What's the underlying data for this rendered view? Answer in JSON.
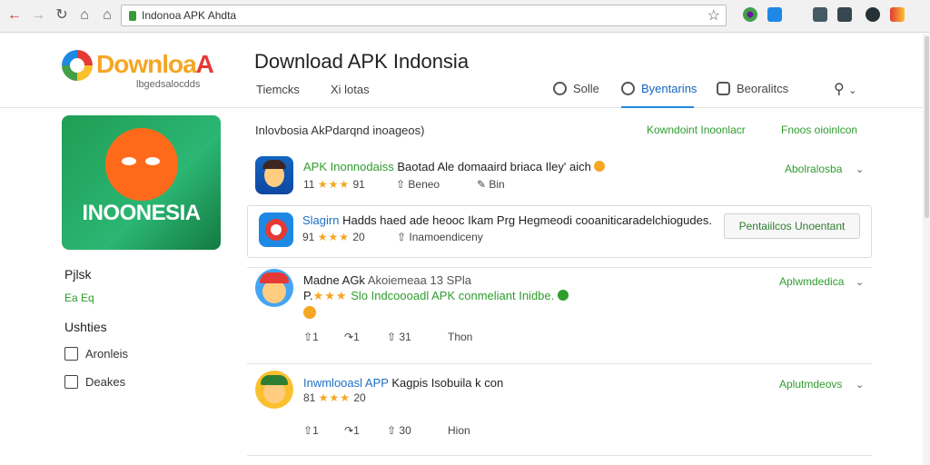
{
  "browser": {
    "url": "Indonoa APK Ahdta",
    "back_icon": "arrow-left-icon",
    "forward_icon": "arrow-right-icon",
    "reload_icon": "reload-icon",
    "home_icon": "home-icon",
    "bookmark_icon": "star-icon"
  },
  "header": {
    "logo_main": "Downloa",
    "logo_accent": "A",
    "logo_sub": "lbgedsalocdds",
    "title": "Download APK Indonsia",
    "subnav": [
      "Tiemcks",
      "Xi lotas"
    ],
    "tabs": [
      {
        "label": "Solle",
        "active": false
      },
      {
        "label": "Byentarins",
        "active": true
      },
      {
        "label": "Beoralitcs",
        "active": false
      }
    ]
  },
  "sidebar": {
    "hero_text": "INOONESIA",
    "section1_title": "Pjlsk",
    "section1_sub": "Ea Eq",
    "section2_title": "Ushties",
    "links": [
      "Aronleis",
      "Deakes"
    ]
  },
  "list": {
    "heading": "Inlovbosia AkPdarqnd inoageos)",
    "head_links": [
      "Kowndoint Inoonlacr",
      "Fnoos oioinlcon"
    ],
    "apps": [
      {
        "name_hl": "APK Inonnodaiss",
        "name_rest": "Baotad Ale domaaird briaca Iley' aich",
        "rating_num": "11",
        "stars": "★★★",
        "rating_val": "91",
        "meta2": "Beneo",
        "meta3": "Bin",
        "action": "Abolralosba"
      },
      {
        "name_hl": "Slagirn",
        "name_rest": "Hadds haed ade heooc Ikam Prg Hegmeodi cooaniticaradelchiogudes.",
        "rating_num": "91",
        "stars": "★★★",
        "rating_val": "20",
        "meta2": "Inamoendiceny",
        "button": "Pentaiilcos Unoentant"
      },
      {
        "name_main": "Madne AGk",
        "name_rest": "Akoiemeaa 13 SPla",
        "line2_prefix": "P.",
        "stars": "★★★",
        "line2_hl": "Slo Indcoooadl APK conmeliant Inidbe.",
        "a1": "1",
        "a2": "1",
        "a3": "31",
        "a4": "Thon",
        "action": "Aplwmdedica"
      },
      {
        "name_hl_blue": "Inwmlooasl APP",
        "name_rest": "Kagpis Isobuila k con",
        "rating_num": "81",
        "stars": "★★★",
        "rating_val": "20",
        "a1": "1",
        "a2": "1",
        "a3": "30",
        "a4": "Hion",
        "action": "Aplutmdeovs"
      }
    ]
  },
  "colors": {
    "accent_green": "#2e9d2e",
    "accent_blue": "#1e88e5",
    "star": "#f5a623"
  }
}
